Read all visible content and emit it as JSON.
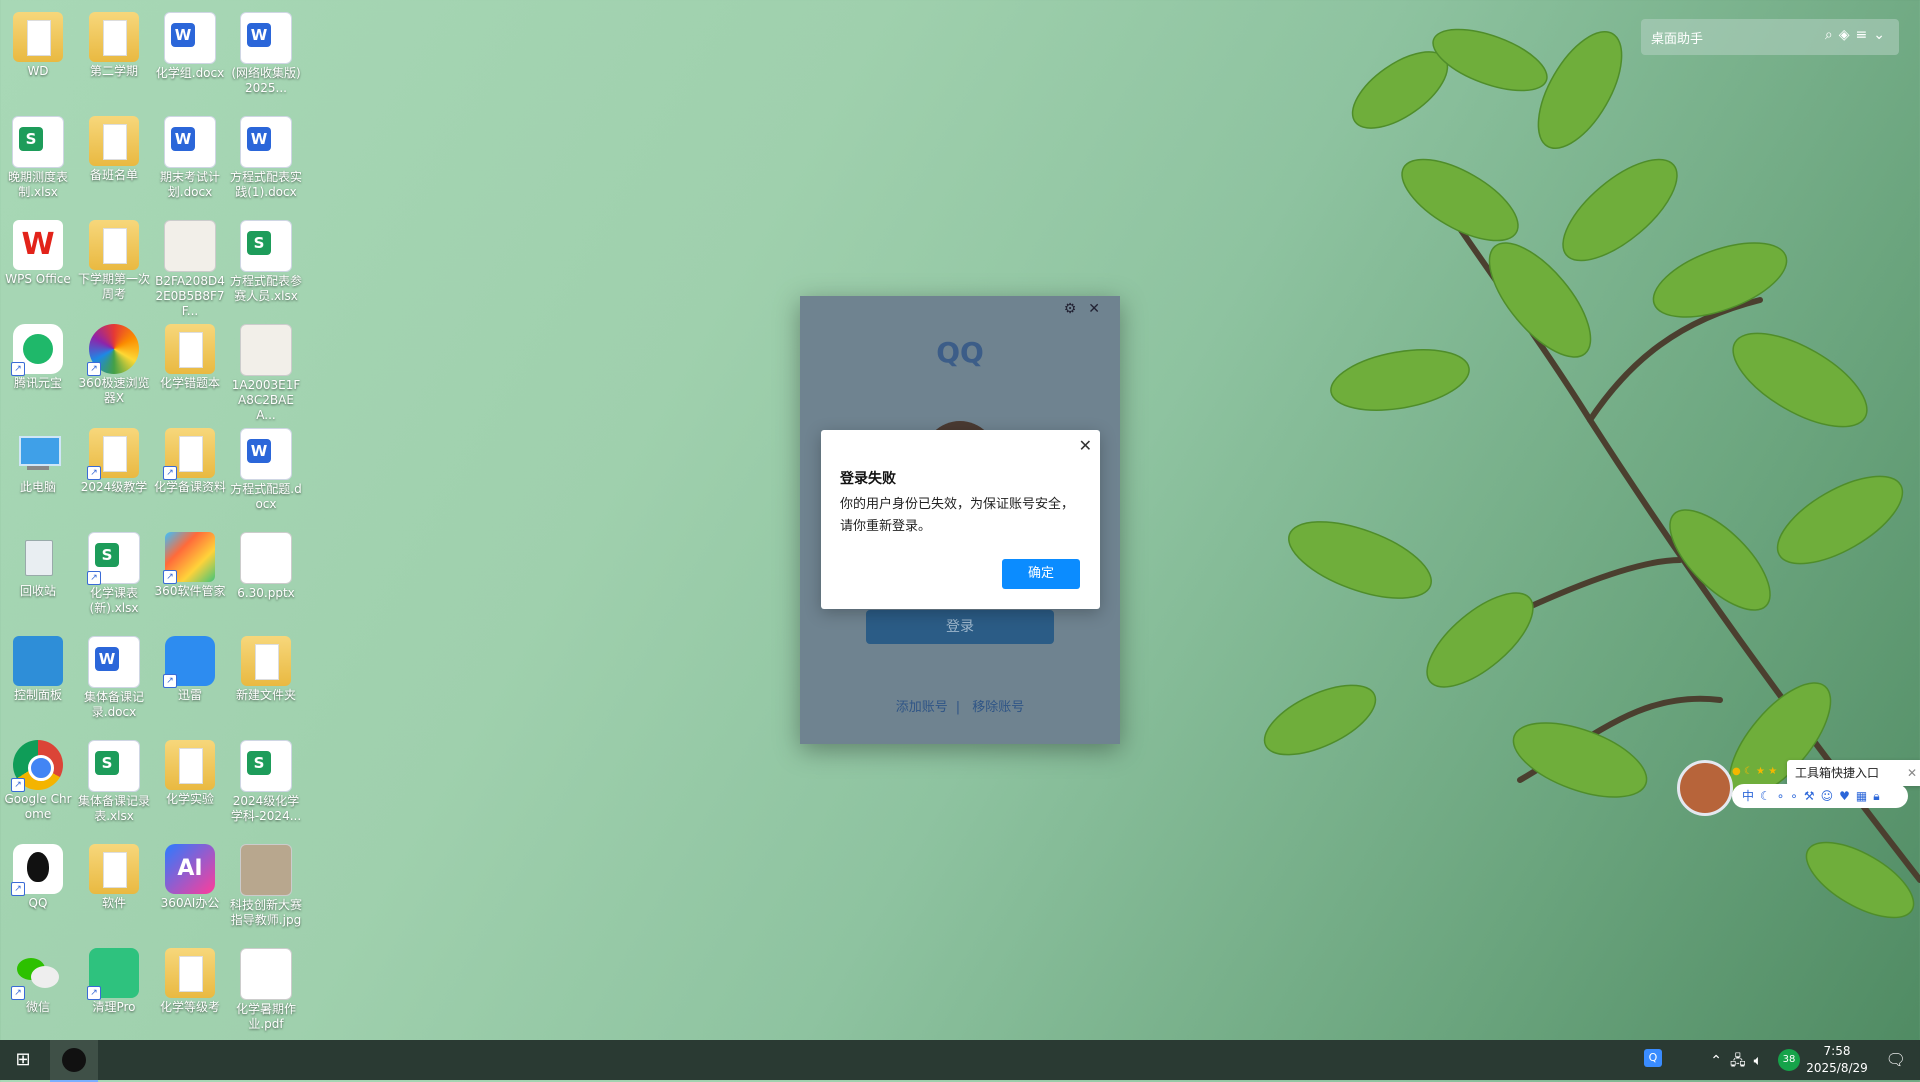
{
  "desktop": {
    "icons": [
      {
        "label": "WD"
      },
      {
        "label": "第二学期"
      },
      {
        "label": "化学组.docx"
      },
      {
        "label": "(网络收集版) 2025..."
      },
      {
        "label": "晚期测度表制.xlsx"
      },
      {
        "label": "备班名单"
      },
      {
        "label": "期末考试计划.docx"
      },
      {
        "label": "方程式配表实践(1).docx"
      },
      {
        "label": "WPS Office"
      },
      {
        "label": "下学期第一次周考"
      },
      {
        "label": "B2FA208D42E0B5B8F7F..."
      },
      {
        "label": "方程式配表参赛人员.xlsx"
      },
      {
        "label": "腾讯元宝"
      },
      {
        "label": "360极速浏览器X"
      },
      {
        "label": "化学错题本"
      },
      {
        "label": "1A2003E1FA8C2BAEA..."
      },
      {
        "label": "此电脑"
      },
      {
        "label": "2024级教学"
      },
      {
        "label": "化学备课资料"
      },
      {
        "label": "方程式配题.docx"
      },
      {
        "label": "回收站"
      },
      {
        "label": "化学课表(新).xlsx"
      },
      {
        "label": "360软件管家"
      },
      {
        "label": "6.30.pptx"
      },
      {
        "label": "控制面板"
      },
      {
        "label": "集体备课记录.docx"
      },
      {
        "label": "迅雷"
      },
      {
        "label": "新建文件夹"
      },
      {
        "label": "Google Chrome"
      },
      {
        "label": "集体备课记录表.xlsx"
      },
      {
        "label": "化学实验"
      },
      {
        "label": "2024级化学学科-2024..."
      },
      {
        "label": "QQ"
      },
      {
        "label": "软件"
      },
      {
        "label": "360AI办公"
      },
      {
        "label": "科技创新大赛指导教师.jpg"
      },
      {
        "label": "微信"
      },
      {
        "label": "清理Pro"
      },
      {
        "label": "化学等级考"
      },
      {
        "label": "化学暑期作业.pdf"
      }
    ]
  },
  "assistant": {
    "title": "桌面助手"
  },
  "qq_window": {
    "logo": "QQ",
    "login_label": "登录",
    "add_account": "添加账号",
    "remove_account": "移除账号"
  },
  "dialog": {
    "title": "登录失败",
    "message": "你的用户身份已失效，为保证账号安全，请你重新登录。",
    "ok": "确定"
  },
  "tool_widget": {
    "tip": "工具箱快捷入口",
    "bar": "中"
  },
  "taskbar": {
    "time": "7:58",
    "date": "2025/8/29",
    "badge": "38"
  },
  "colors": {
    "primary_button": "#0b8cff",
    "taskbar": "#2a3a33"
  }
}
